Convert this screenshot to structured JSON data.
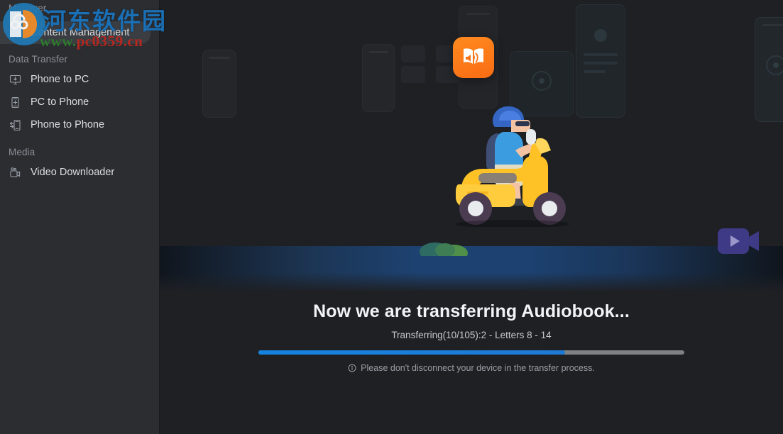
{
  "app": {
    "background_color": "#1e2024",
    "sidebar_color": "#2b2d31",
    "accent_color": "#1583e0"
  },
  "sidebar": {
    "manager_label": "Manager",
    "groups": [
      {
        "label": "",
        "items": [
          {
            "label": "Content Management",
            "icon": "grid-icon",
            "active": true
          }
        ]
      },
      {
        "label": "Data Transfer",
        "items": [
          {
            "label": "Phone to PC",
            "icon": "phone-to-pc-icon",
            "active": false
          },
          {
            "label": "PC to Phone",
            "icon": "pc-to-phone-icon",
            "active": false
          },
          {
            "label": "Phone to Phone",
            "icon": "phone-to-phone-icon",
            "active": false
          }
        ]
      },
      {
        "label": "Media",
        "items": [
          {
            "label": "Video Downloader",
            "icon": "video-camera-icon",
            "active": false
          }
        ]
      }
    ]
  },
  "main": {
    "title": "Now we are transferring Audiobook...",
    "subtitle": "Transferring(10/105):2 - Letters 8 - 14",
    "progress_percent": 72,
    "hint": "Please don't disconnect your device in the transfer process.",
    "hint_icon": "info-icon",
    "illustration": {
      "name": "scooter-delivery-illustration",
      "app_icon": "audiobook-icon",
      "badge_icon": "video-play-badge-icon"
    }
  },
  "watermark": {
    "site_name": "河东软件园",
    "url_prefix": "www.",
    "url_main": "pc0359",
    "url_suffix": ".cn"
  }
}
